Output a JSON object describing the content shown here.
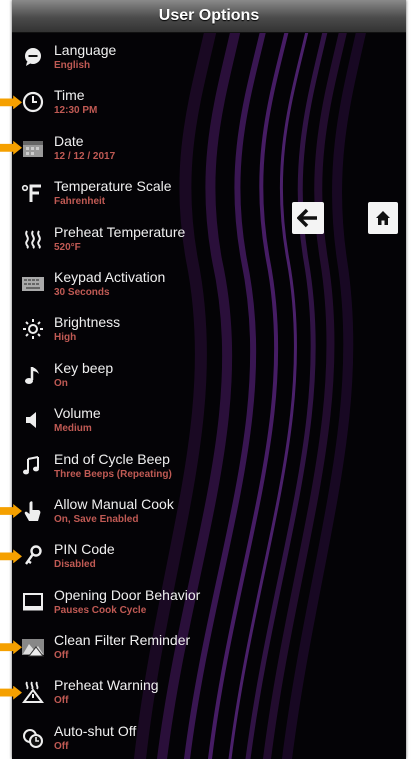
{
  "header": {
    "title": "User Options"
  },
  "accent_colors": {
    "value_text": "#c05a54",
    "callout_arrow": "#f5a000"
  },
  "nav": {
    "back_icon": "left-arrow-icon",
    "home_icon": "home-icon"
  },
  "options": [
    {
      "label": "Language",
      "value": "English",
      "icon": "speech-bubble-icon",
      "callout": false
    },
    {
      "label": "Time",
      "value": "12:30 PM",
      "icon": "clock-icon",
      "callout": true
    },
    {
      "label": "Date",
      "value": "12 / 12 / 2017",
      "icon": "calendar-icon",
      "callout": true
    },
    {
      "label": "Temperature Scale",
      "value": "Fahrenheit",
      "icon": "degree-f-icon",
      "callout": false
    },
    {
      "label": "Preheat Temperature",
      "value": "520°F",
      "icon": "heat-waves-icon",
      "callout": false
    },
    {
      "label": "Keypad Activation",
      "value": "30 Seconds",
      "icon": "keypad-icon",
      "callout": false
    },
    {
      "label": "Brightness",
      "value": "High",
      "icon": "sun-icon",
      "callout": false
    },
    {
      "label": "Key beep",
      "value": "On",
      "icon": "music-note-icon",
      "callout": false
    },
    {
      "label": "Volume",
      "value": "Medium",
      "icon": "speaker-icon",
      "callout": false
    },
    {
      "label": "End of Cycle Beep",
      "value": "Three Beeps (Repeating)",
      "icon": "double-note-icon",
      "callout": false
    },
    {
      "label": "Allow Manual Cook",
      "value": "On, Save Enabled",
      "icon": "hand-pointer-icon",
      "callout": true
    },
    {
      "label": "PIN Code",
      "value": "Disabled",
      "icon": "key-icon",
      "callout": true
    },
    {
      "label": "Opening Door Behavior",
      "value": "Pauses Cook Cycle",
      "icon": "oven-door-icon",
      "callout": false
    },
    {
      "label": "Clean Filter Reminder",
      "value": "Off",
      "icon": "filter-warning-icon",
      "callout": true
    },
    {
      "label": "Preheat Warning",
      "value": "Off",
      "icon": "heat-warning-icon",
      "callout": true
    },
    {
      "label": "Auto-shut Off",
      "value": "Off",
      "icon": "power-timer-icon",
      "callout": false
    }
  ]
}
